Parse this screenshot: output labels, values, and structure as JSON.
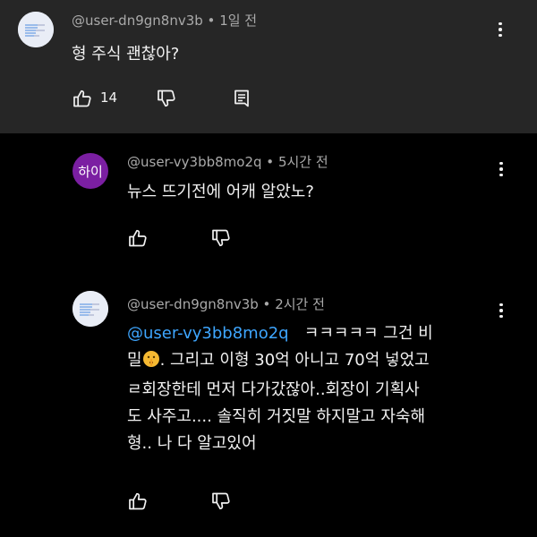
{
  "top_comment": {
    "author": "@user-dn9gn8nv3b",
    "separator": "•",
    "time": "1일 전",
    "text": "형 주식 괜찮아?",
    "like_count": "14"
  },
  "replies": [
    {
      "author": "@user-vy3bb8mo2q",
      "separator": "•",
      "time": "5시간 전",
      "avatar_text": "하이",
      "avatar_color": "#7b1fa2",
      "text": "뉴스 뜨기전에 어캐 알았노?"
    },
    {
      "author": "@user-dn9gn8nv3b",
      "separator": "•",
      "time": "2시간 전",
      "mention": "@user-vy3bb8mo2q",
      "line1_rest": "ㅋㅋㅋㅋㅋ 그건 비",
      "line2_a": "밀",
      "line2_b": ". 그리고 이형 30억 아니고 70억 넣었고",
      "line3": "ㄹ회장한테 먼저 다가갔잖아..회장이 기획사",
      "line4": "도 사주고.... 솔직히 거짓말 하지말고 자숙해",
      "line5": "형.. 나 다 알고있어",
      "emoji": "shushing-face"
    }
  ],
  "colors": {
    "top_background": "#262626",
    "thread_background": "#000000",
    "mention": "#3ea6ff",
    "meta_text": "#aaaaaa"
  },
  "icons": {
    "like": "thumbs-up-icon",
    "dislike": "thumbs-down-icon",
    "reply": "reply-icon",
    "menu": "more-vert-icon"
  }
}
